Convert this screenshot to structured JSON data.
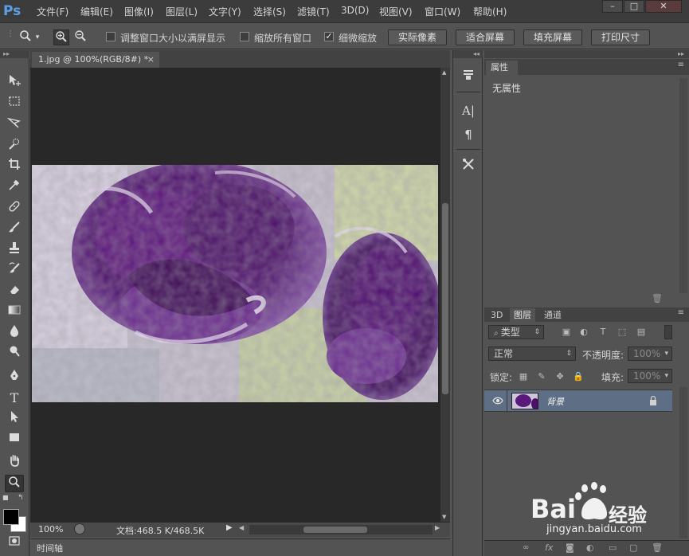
{
  "menubar": {
    "logo": "Ps",
    "items": [
      "文件(F)",
      "编辑(E)",
      "图像(I)",
      "图层(L)",
      "文字(Y)",
      "选择(S)",
      "滤镜(T)",
      "3D(D)",
      "视图(V)",
      "窗口(W)",
      "帮助(H)"
    ],
    "window_buttons": [
      "–",
      "□",
      "✕"
    ]
  },
  "optionsbar": {
    "zoom_tool_icon": "zoom-icon",
    "zoom_in_icon": "zoom-in-icon",
    "zoom_out_icon": "zoom-out-icon",
    "check_resize": {
      "label": "调整窗口大小以满屏显示",
      "checked": false
    },
    "check_zoom_all": {
      "label": "缩放所有窗口",
      "checked": false
    },
    "check_scrubby": {
      "label": "细微缩放",
      "checked": true
    },
    "buttons": [
      "实际像素",
      "适合屏幕",
      "填充屏幕",
      "打印尺寸"
    ]
  },
  "document": {
    "tab_title": "1.jpg @ 100%(RGB/8#) *",
    "tab_close": "×",
    "zoom": "100%",
    "doc_info": "文档:468.5 K/468.5K",
    "timeline_label": "时间轴"
  },
  "properties": {
    "tab": "属性",
    "content": "无属性"
  },
  "layers": {
    "tabs": [
      "3D",
      "图层",
      "通道"
    ],
    "active_tab": "图层",
    "filter_kind": "类型",
    "blend_mode": "正常",
    "opacity_label": "不透明度:",
    "opacity_value": "100%",
    "lock_label": "锁定:",
    "fill_label": "填充:",
    "fill_value": "100%",
    "layer_name": "背景"
  },
  "watermark": {
    "brand": "Bai",
    "brand_suffix": "经验",
    "url": "jingyan.baidu.com"
  },
  "colors": {
    "accent": "#5ba0e6",
    "selected_layer": "#5e6e84"
  }
}
